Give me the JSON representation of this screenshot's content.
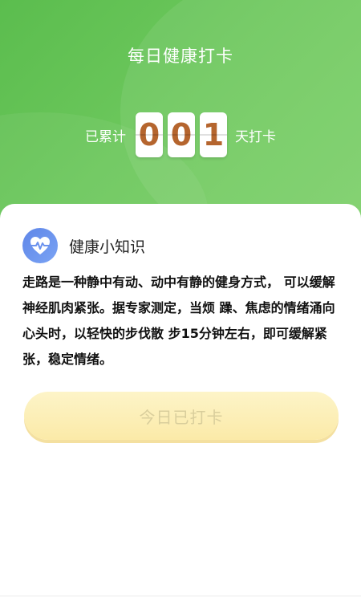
{
  "header": {
    "title": "每日健康打卡",
    "counter_prefix": "已累计",
    "counter_suffix": "天打卡",
    "digits": [
      "0",
      "0",
      "1"
    ]
  },
  "tip": {
    "title": "健康小知识",
    "icon": "heart-pulse-icon",
    "text": "走路是一种静中有动、动中有静的健身方式， 可以缓解神经肌肉紧张。据专家测定，当烦 躁、焦虑的情绪涌向心头时，以轻快的步伐散 步15分钟左右，即可缓解紧张，稳定情绪。"
  },
  "action": {
    "checkin_label": "今日已打卡"
  },
  "colors": {
    "header_green": "#6cc75c",
    "digit_color": "#b5652e",
    "icon_blue": "#6b92ee",
    "button_yellow": "#fbeaa8"
  }
}
